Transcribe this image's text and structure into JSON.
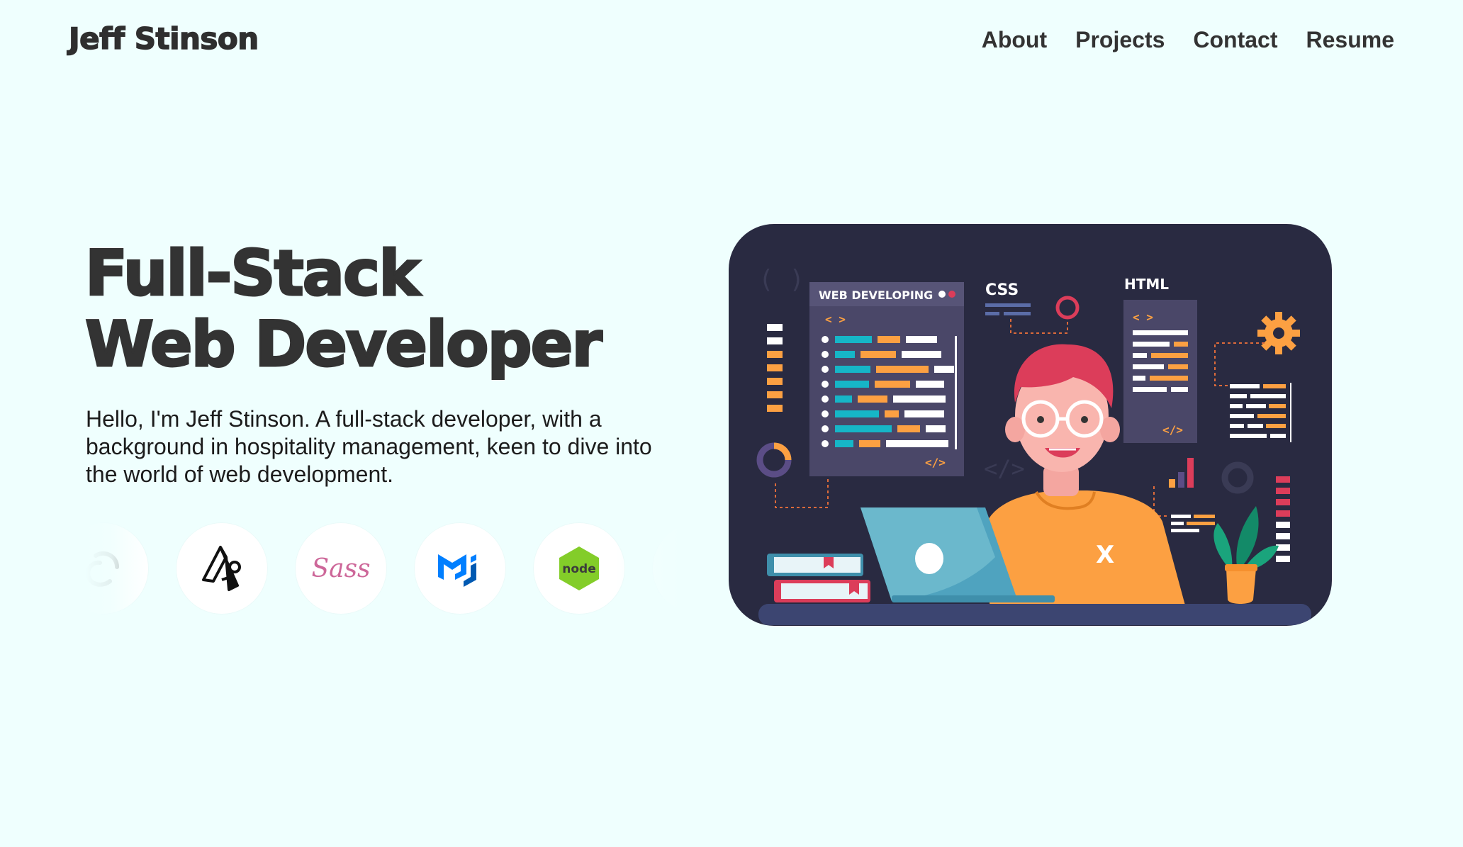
{
  "header": {
    "brand": "Jeff Stinson",
    "nav": [
      "About",
      "Projects",
      "Contact",
      "Resume"
    ]
  },
  "hero": {
    "title_line1": "Full-Stack",
    "title_line2": "Web Developer",
    "intro": "Hello, I'm Jeff Stinson. A full-stack developer, with a background in hospitality management, keen to dive into the world of web development."
  },
  "tech_icons": [
    "redux-icon",
    "next-js-icon",
    "sass-icon",
    "material-ui-icon",
    "node-js-icon",
    "firebase-icon"
  ],
  "illustration": {
    "panel_title": "WEB DEVELOPING",
    "css_label": "CSS",
    "html_label": "HTML",
    "code_open": "< >",
    "code_close": "</>",
    "sass_text": "Sass",
    "node_text": "node",
    "shirt_letter": "X"
  },
  "colors": {
    "background": "#effffe",
    "text": "#333333",
    "illustration_bg": "#292a41",
    "accent_orange": "#fca042",
    "accent_teal": "#16b6c7",
    "accent_pink": "#dc3d5a"
  }
}
